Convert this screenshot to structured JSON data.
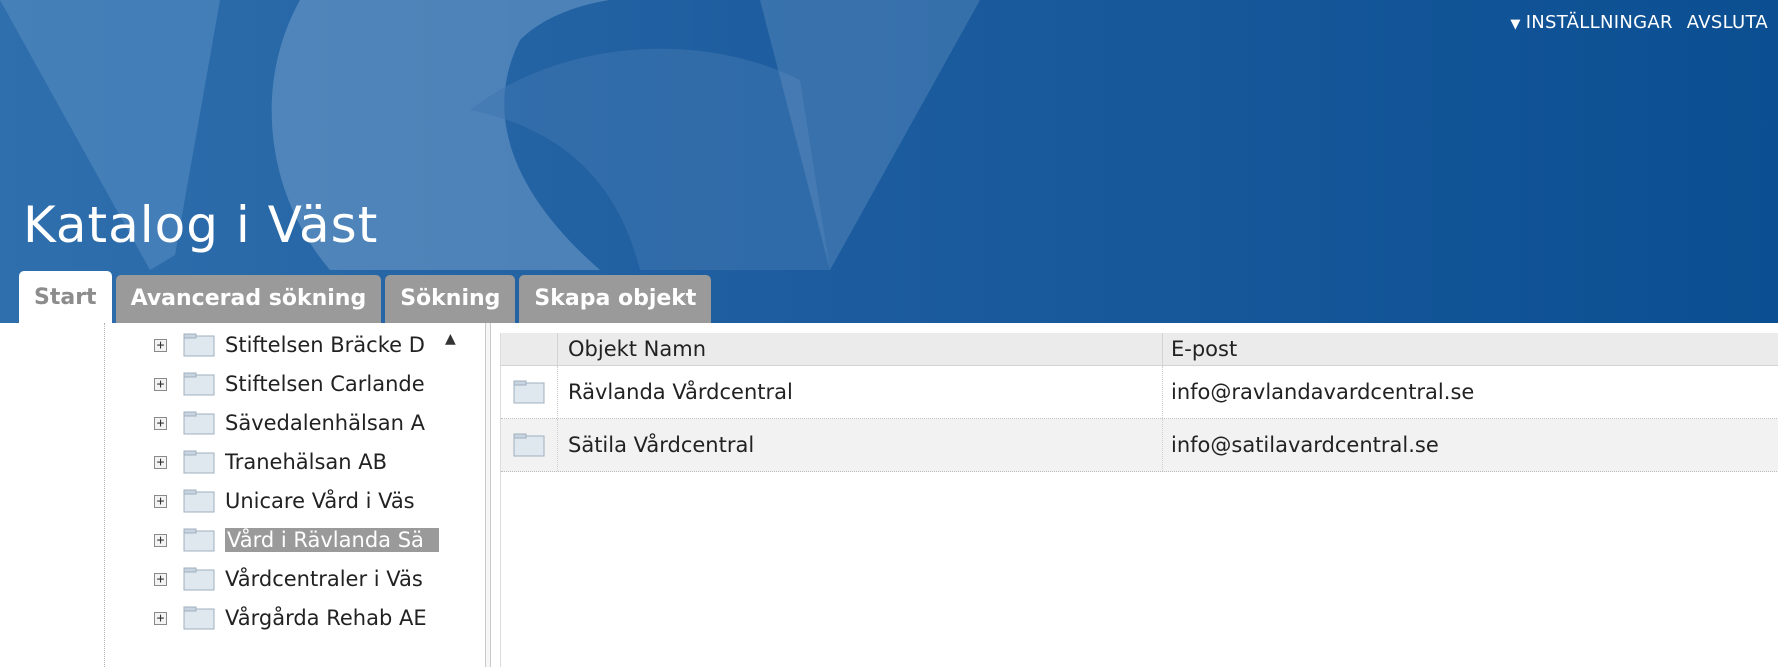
{
  "header": {
    "title": "Katalog i Väst",
    "settings_label": "INSTÄLLNINGAR",
    "logout_label": "AVSLUTA"
  },
  "tabs": [
    {
      "label": "Start",
      "active": true
    },
    {
      "label": "Avancerad sökning",
      "active": false
    },
    {
      "label": "Sökning",
      "active": false
    },
    {
      "label": "Skapa objekt",
      "active": false
    }
  ],
  "tree": {
    "items": [
      {
        "label": "Stiftelsen Bräcke D",
        "selected": false
      },
      {
        "label": "Stiftelsen Carlande",
        "selected": false
      },
      {
        "label": "Sävedalenhälsan A",
        "selected": false
      },
      {
        "label": "Tranehälsan AB",
        "selected": false
      },
      {
        "label": "Unicare Vård i Väs",
        "selected": false
      },
      {
        "label": "Vård i Rävlanda Sä",
        "selected": true
      },
      {
        "label": "Vårdcentraler i Väs",
        "selected": false
      },
      {
        "label": "Vårgårda Rehab AE",
        "selected": false
      }
    ]
  },
  "table": {
    "columns": [
      "Objekt Namn",
      "E-post"
    ],
    "rows": [
      {
        "name": "Rävlanda Vårdcentral",
        "email": "info@ravlandavardcentral.se"
      },
      {
        "name": "Sätila Vårdcentral",
        "email": "info@satilavardcentral.se"
      }
    ]
  },
  "colors": {
    "header_blue": "#1d5d9f",
    "tab_gray": "#9a9a9a"
  },
  "icons": [
    "triangle-down-icon",
    "expand-plus-icon",
    "folder-icon",
    "scroll-up-arrow-icon"
  ]
}
